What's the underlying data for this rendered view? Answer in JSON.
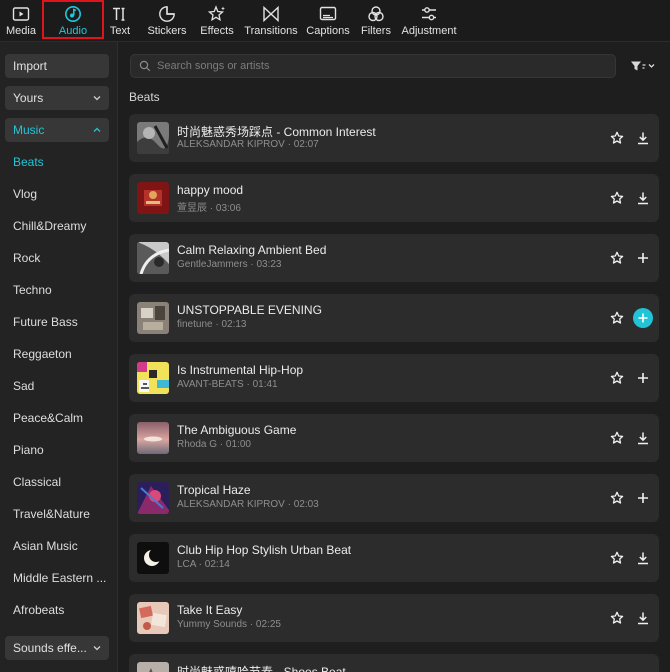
{
  "toolbar": {
    "tabs": [
      {
        "label": "Media",
        "icon": "media-icon"
      },
      {
        "label": "Audio",
        "icon": "audio-icon",
        "active": true
      },
      {
        "label": "Text",
        "icon": "text-icon"
      },
      {
        "label": "Stickers",
        "icon": "stickers-icon"
      },
      {
        "label": "Effects",
        "icon": "effects-icon"
      },
      {
        "label": "Transitions",
        "icon": "transitions-icon"
      },
      {
        "label": "Captions",
        "icon": "captions-icon"
      },
      {
        "label": "Filters",
        "icon": "filters-icon"
      },
      {
        "label": "Adjustment",
        "icon": "adjustment-icon"
      }
    ]
  },
  "sidebar": {
    "import_label": "Import",
    "yours_label": "Yours",
    "music_label": "Music",
    "categories": [
      "Beats",
      "Vlog",
      "Chill&Dreamy",
      "Rock",
      "Techno",
      "Future Bass",
      "Reggaeton",
      "Sad",
      "Peace&Calm",
      "Piano",
      "Classical",
      "Travel&Nature",
      "Asian Music",
      "Middle Eastern ...",
      "Afrobeats"
    ],
    "active_category": "Beats",
    "sounds_label": "Sounds effe..."
  },
  "main": {
    "search_placeholder": "Search songs or artists",
    "section_title": "Beats",
    "tracks": [
      {
        "title": "时尚魅惑秀场踩点 - Common Interest",
        "meta": "ALEKSANDAR KIPROV · 02:07",
        "action": "download"
      },
      {
        "title": "happy mood",
        "meta": "萱昱辰 · 03:06",
        "action": "download"
      },
      {
        "title": "Calm Relaxing Ambient Bed",
        "meta": "GentleJammers · 03:23",
        "action": "add"
      },
      {
        "title": "UNSTOPPABLE EVENING",
        "meta": "finetune · 02:13",
        "action": "add-active"
      },
      {
        "title": "Is Instrumental Hip-Hop",
        "meta": "AVANT-BEATS · 01:41",
        "action": "add"
      },
      {
        "title": "The Ambiguous Game",
        "meta": "Rhoda G · 01:00",
        "action": "download"
      },
      {
        "title": "Tropical Haze",
        "meta": "ALEKSANDAR KIPROV · 02:03",
        "action": "add"
      },
      {
        "title": "Club Hip Hop Stylish Urban Beat",
        "meta": "LCA · 02:14",
        "action": "download"
      },
      {
        "title": "Take It Easy",
        "meta": "Yummy Sounds · 02:25",
        "action": "download"
      },
      {
        "title": "时尚魅惑嘻哈节奏 - Shoes Beat",
        "meta": "",
        "action": "download"
      }
    ]
  },
  "colors": {
    "accent": "#22c7d8",
    "highlight_box": "#e0141c"
  }
}
